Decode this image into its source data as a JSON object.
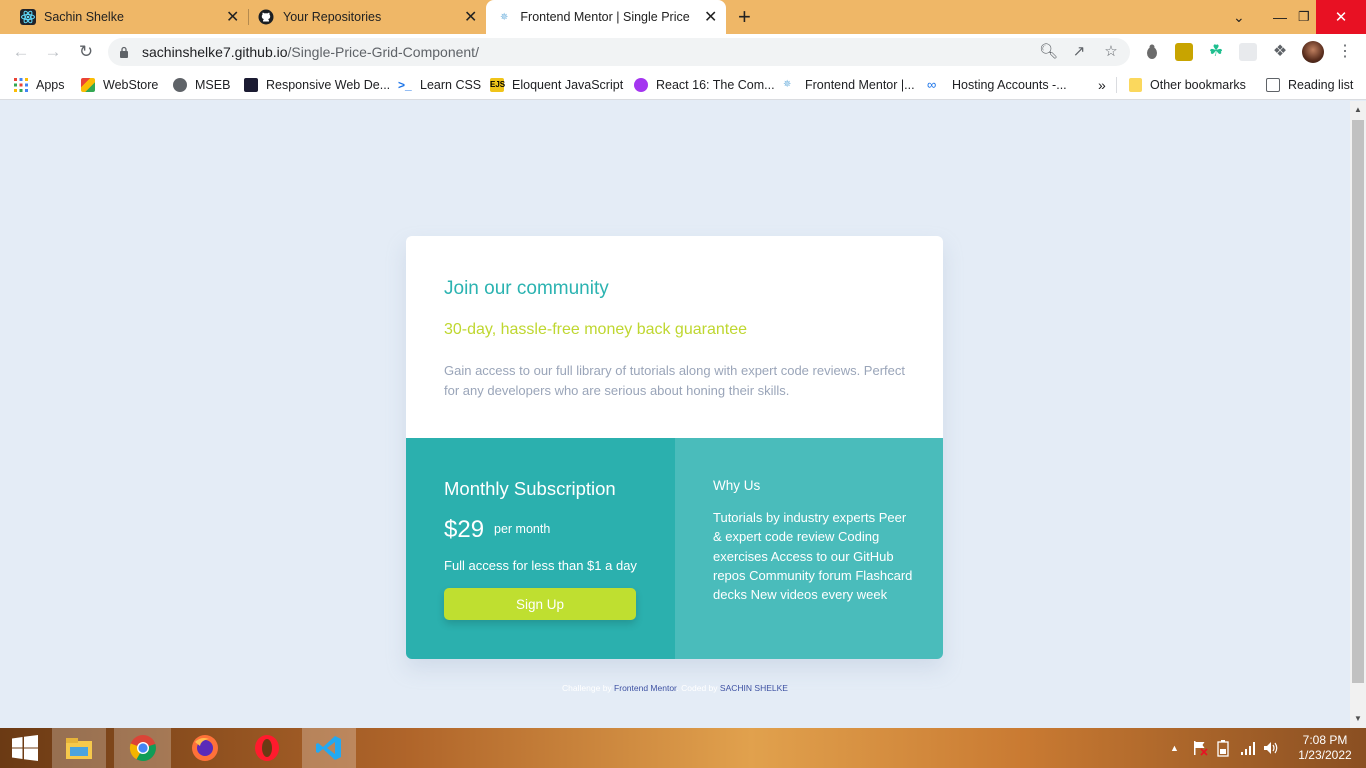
{
  "browser": {
    "tabs": [
      {
        "title": "Sachin Shelke",
        "active": false
      },
      {
        "title": "Your Repositories",
        "active": false
      },
      {
        "title": "Frontend Mentor | Single Price G",
        "active": true
      }
    ],
    "new_tab_label": "+",
    "url_host": "sachinshelke7.github.io",
    "url_path": "/Single-Price-Grid-Component/",
    "bookmarks": [
      {
        "label": "Apps"
      },
      {
        "label": "WebStore"
      },
      {
        "label": "MSEB"
      },
      {
        "label": "Responsive Web De..."
      },
      {
        "label": "Learn CSS"
      },
      {
        "label": "Eloquent JavaScript"
      },
      {
        "label": "React 16: The Com..."
      },
      {
        "label": "Frontend Mentor |..."
      },
      {
        "label": "Hosting Accounts -..."
      }
    ],
    "more_bookmarks_label": "»",
    "other_bookmarks": "Other bookmarks",
    "reading_list": "Reading list"
  },
  "card": {
    "title": "Join our community",
    "subtitle": "30-day, hassle-free money back guarantee",
    "description": "Gain access to our full library of tutorials along with expert code reviews. Perfect for any developers who are serious about honing their skills.",
    "subscription": {
      "title": "Monthly Subscription",
      "price": "$29",
      "period": "per month",
      "access": "Full access for less than $1 a day",
      "button": "Sign Up"
    },
    "why_us": {
      "title": "Why Us",
      "text": "Tutorials by industry experts Peer & expert code review Coding exercises Access to our GitHub repos Community forum Flashcard decks New videos every week"
    }
  },
  "attribution": {
    "challenge_prefix": "Challenge by",
    "challenge_link": "Frontend Mentor",
    "coded_prefix": ". Coded by",
    "coded_link": "SACHIN SHELKE"
  },
  "taskbar": {
    "time": "7:08 PM",
    "date": "1/23/2022"
  },
  "colors": {
    "accent_cyan": "#2bb3b1",
    "accent_lime": "#bfdf30",
    "page_bg": "#e4ecf6"
  }
}
